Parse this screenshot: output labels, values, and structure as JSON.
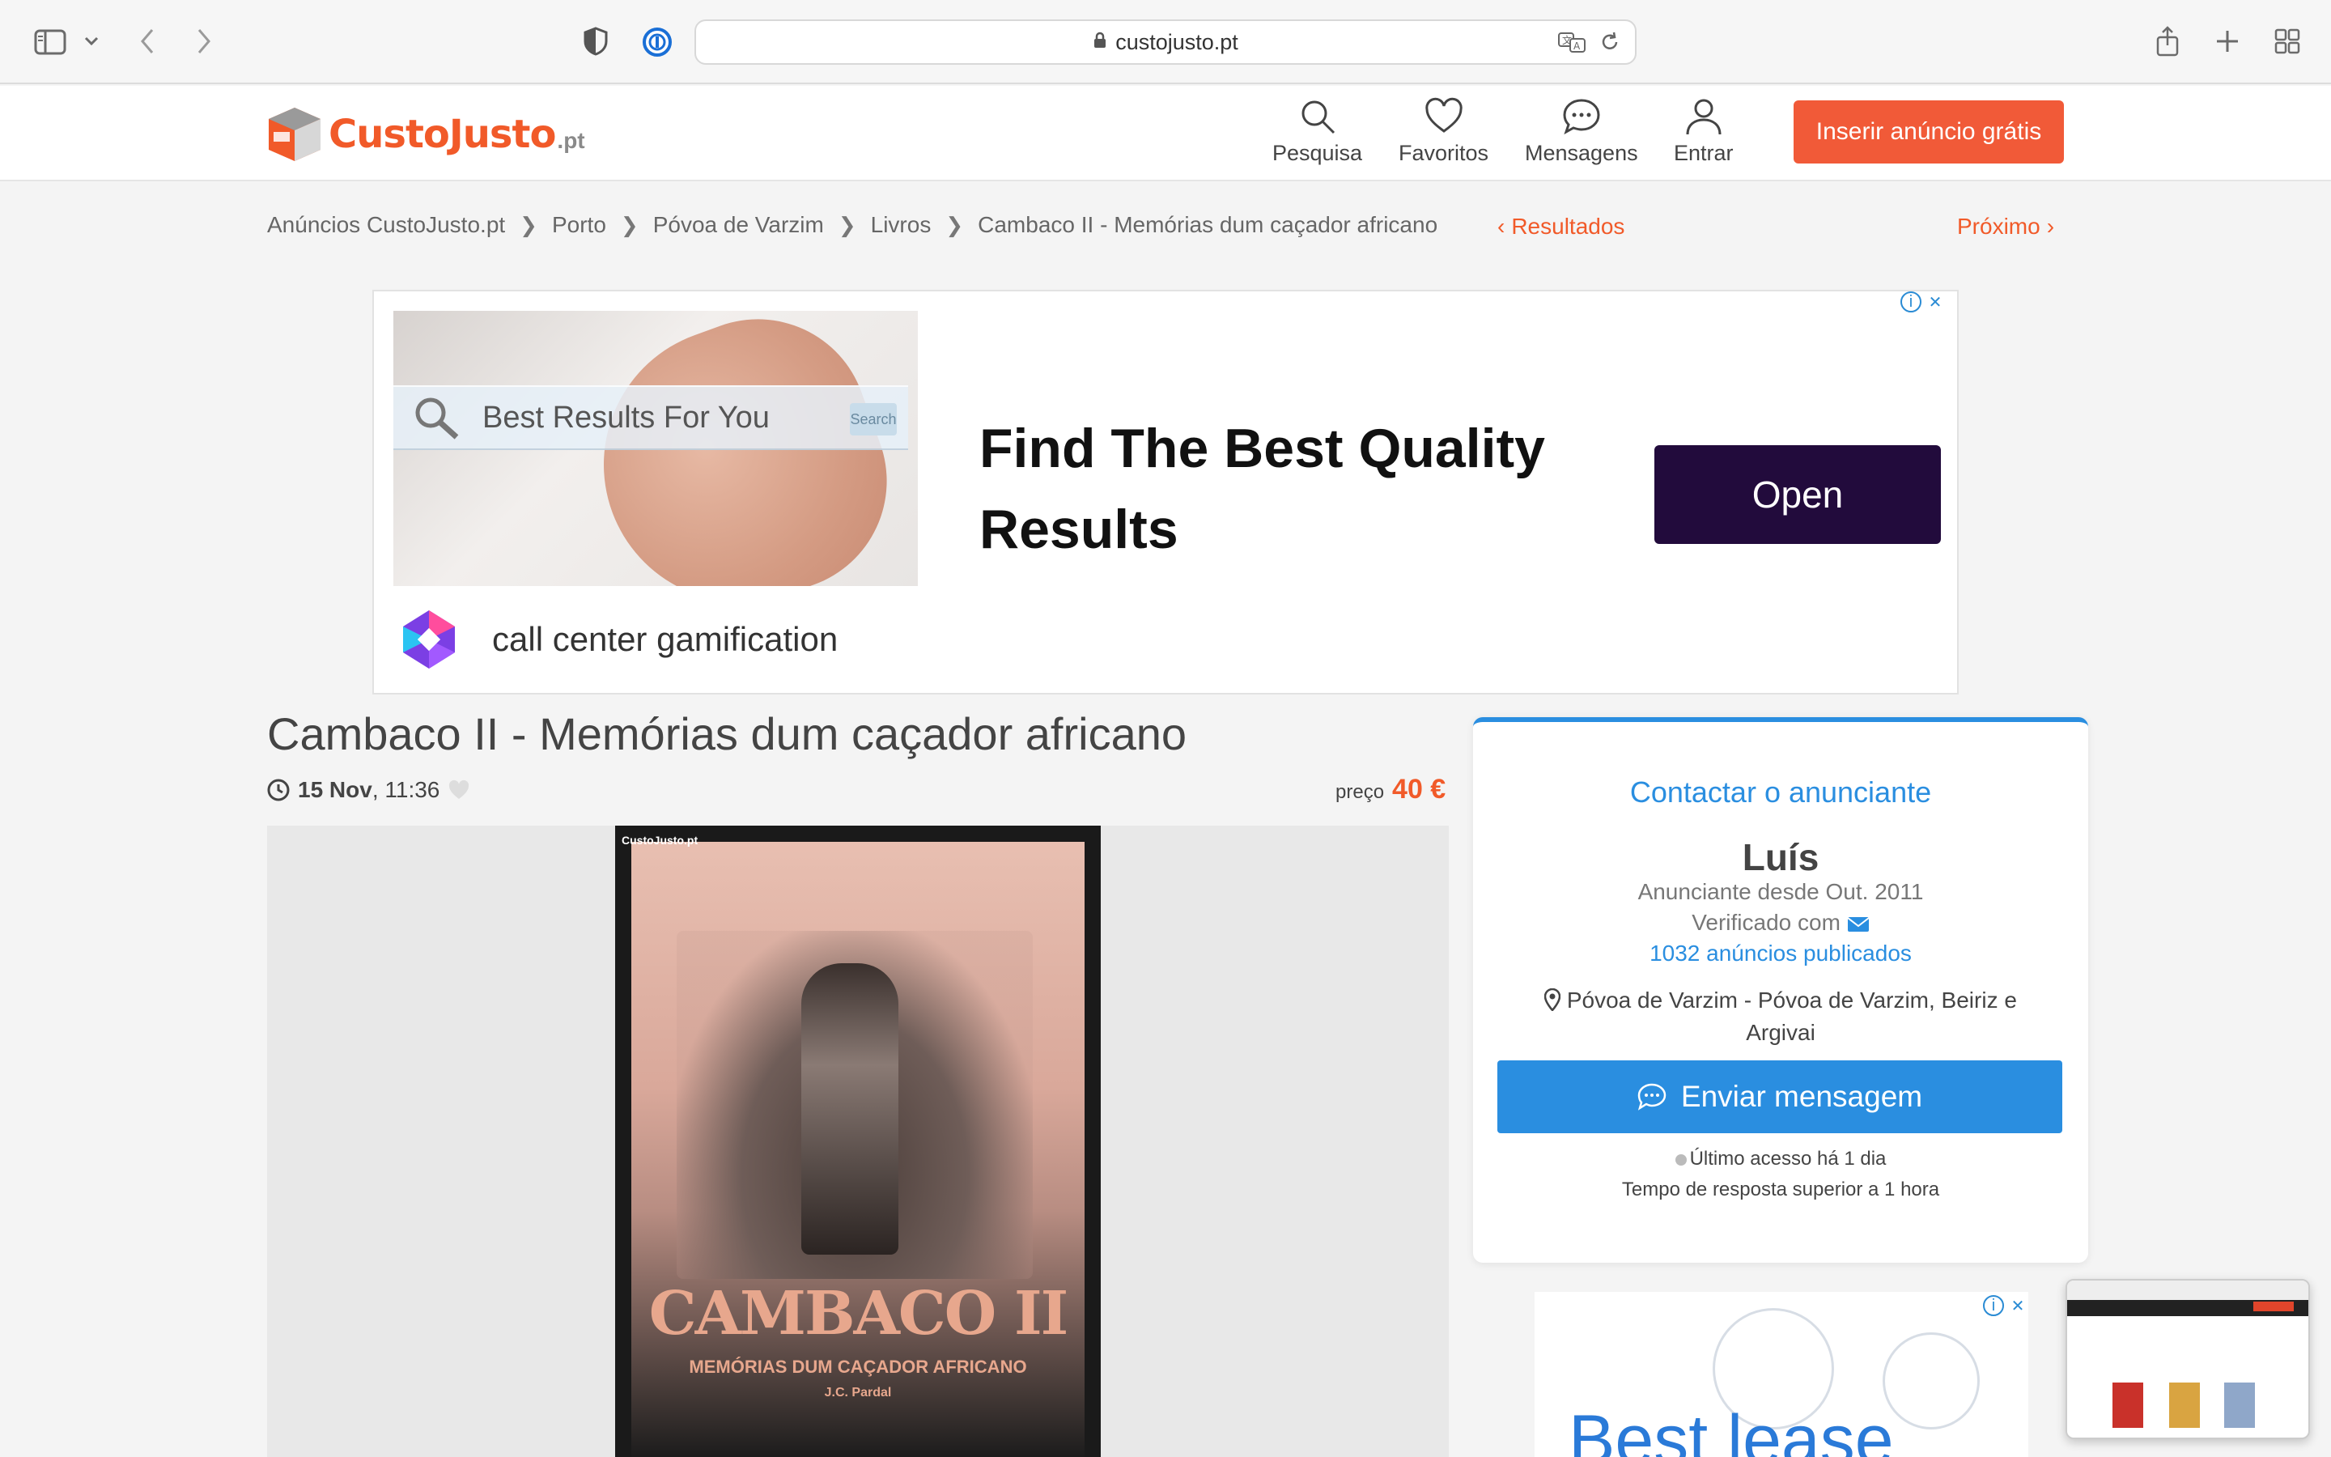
{
  "browser": {
    "url": "custojusto.pt"
  },
  "header": {
    "logo_text": "CustoJusto",
    "logo_tld": ".pt",
    "nav": [
      {
        "label": "Pesquisa",
        "icon": "search-icon"
      },
      {
        "label": "Favoritos",
        "icon": "heart-icon"
      },
      {
        "label": "Mensagens",
        "icon": "chat-icon"
      },
      {
        "label": "Entrar",
        "icon": "user-icon"
      }
    ],
    "cta_label": "Inserir anúncio grátis"
  },
  "breadcrumb": [
    "Anúncios CustoJusto.pt",
    "Porto",
    "Póvoa de Varzim",
    "Livros",
    "Cambaco II - Memórias dum caçador africano"
  ],
  "pager": {
    "prev_label": "Resultados",
    "next_label": "Próximo"
  },
  "ad": {
    "search_text": "Best Results For You",
    "search_button": "Search",
    "headline": "Find The Best Quality Results",
    "button_label": "Open",
    "brand_text": "call center gamification"
  },
  "listing": {
    "title": "Cambaco II - Memórias dum caçador africano",
    "date": "15 Nov",
    "time": ", 11:36",
    "price_label": "preço",
    "price_value": "40 €",
    "image": {
      "watermark": "CustoJusto.pt",
      "book_title": "CAMBACO II",
      "book_subtitle": "MEMÓRIAS DUM CAÇADOR AFRICANO",
      "book_author": "J.C. Pardal"
    }
  },
  "contact": {
    "title": "Contactar o anunciante",
    "name": "Luís",
    "since": "Anunciante desde Out. 2011",
    "verified": "Verificado com",
    "ads_count": "1032 anúncios publicados",
    "location": "Póvoa de Varzim - Póvoa de Varzim, Beiriz e Argivai",
    "button_label": "Enviar mensagem",
    "last_access": "Último acesso há 1 dia",
    "response_time": "Tempo de resposta superior a 1 hora"
  },
  "ad2": {
    "text": "Best lease"
  },
  "colors": {
    "brand_orange": "#f15a29",
    "contact_blue": "#2a8ee0",
    "ad_button": "#220b3c"
  }
}
